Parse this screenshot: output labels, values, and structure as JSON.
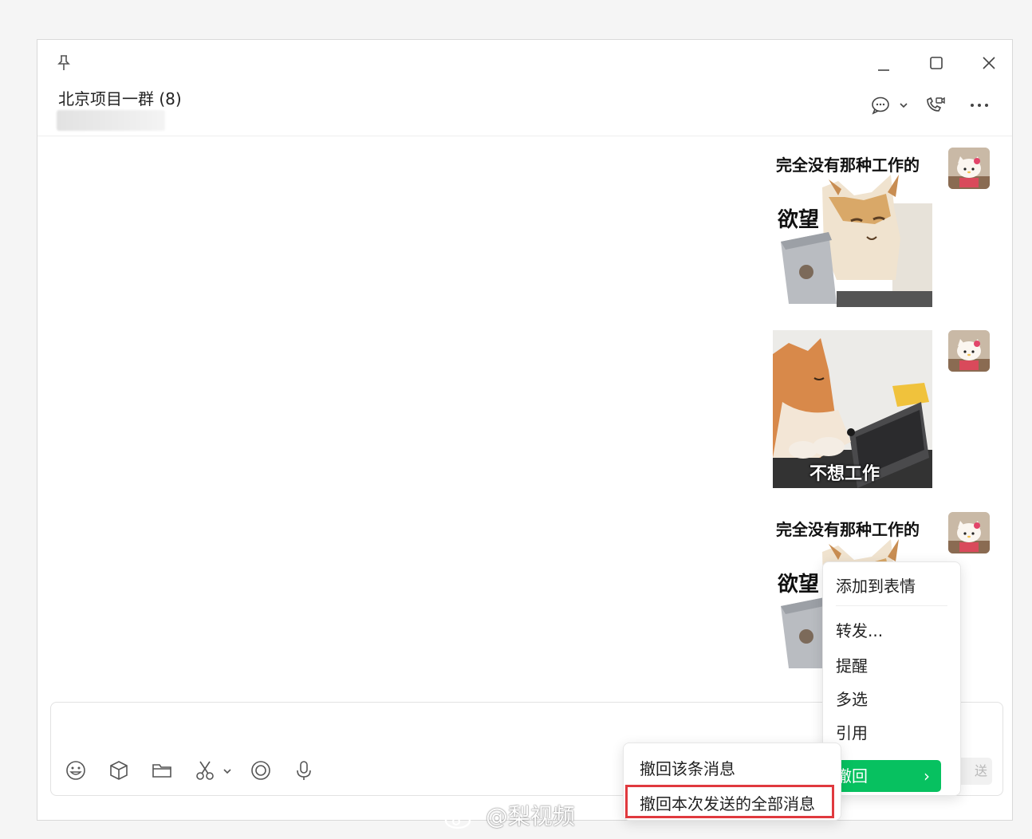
{
  "window": {
    "pin_icon": "pin-icon",
    "minimize_icon": "minimize-icon",
    "maximize_icon": "maximize-icon",
    "close_icon": "close-icon"
  },
  "header": {
    "title": "北京项目一群 (8)",
    "icons": [
      "chat-bubble-icon",
      "chevron-down-icon",
      "video-call-icon",
      "more-icon"
    ]
  },
  "messages": [
    {
      "type": "sticker",
      "caption_top": "完全没有那种工作的",
      "caption_side": "欲望"
    },
    {
      "type": "sticker",
      "caption_bottom": "不想工作"
    },
    {
      "type": "sticker",
      "caption_top": "完全没有那种工作的",
      "caption_side": "欲望"
    }
  ],
  "context_menu": {
    "items": [
      "添加到表情",
      "转发...",
      "提醒",
      "多选",
      "引用"
    ],
    "recall_label": "撤回",
    "recall_chevron": "›"
  },
  "recall_submenu": {
    "items": [
      "撤回该条消息",
      "撤回本次发送的全部消息"
    ]
  },
  "toolbar": {
    "icons": [
      "emoji-icon",
      "cube-icon",
      "folder-icon",
      "scissors-icon",
      "chevron-down-icon",
      "record-icon",
      "microphone-icon"
    ],
    "send_label": "送"
  },
  "watermark": "@梨视频",
  "colors": {
    "accent": "#07c160",
    "highlight": "#e0393e"
  }
}
